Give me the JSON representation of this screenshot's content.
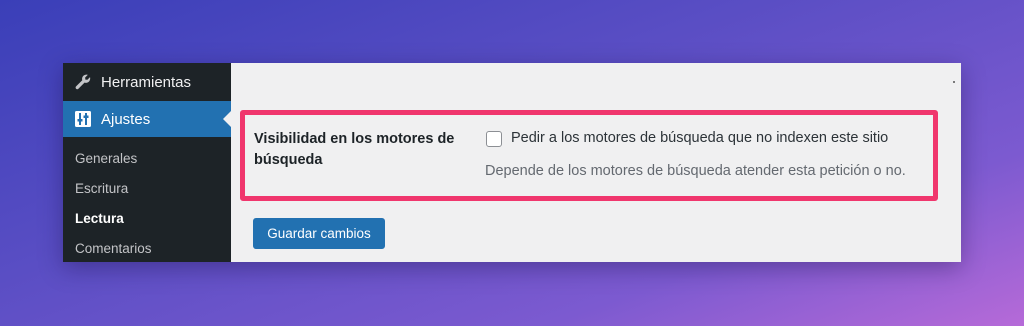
{
  "sidebar": {
    "tools": {
      "label": "Herramientas",
      "icon": "wrench-icon"
    },
    "settings": {
      "label": "Ajustes",
      "icon": "settings-sliders-icon"
    },
    "submenu": [
      {
        "label": "Generales",
        "current": false
      },
      {
        "label": "Escritura",
        "current": false
      },
      {
        "label": "Lectura",
        "current": true
      },
      {
        "label": "Comentarios",
        "current": false
      }
    ]
  },
  "main": {
    "field_label": "Visibilidad en los motores de búsqueda",
    "checkbox_label": "Pedir a los motores de búsqueda que no indexen este sitio",
    "checkbox_checked": false,
    "description": "Depende de los motores de búsqueda atender esta petición o no.",
    "save_label": "Guardar cambios"
  },
  "colors": {
    "accent": "#2271b1",
    "sidebar_bg": "#1d2327",
    "highlight": "#f0366d"
  }
}
